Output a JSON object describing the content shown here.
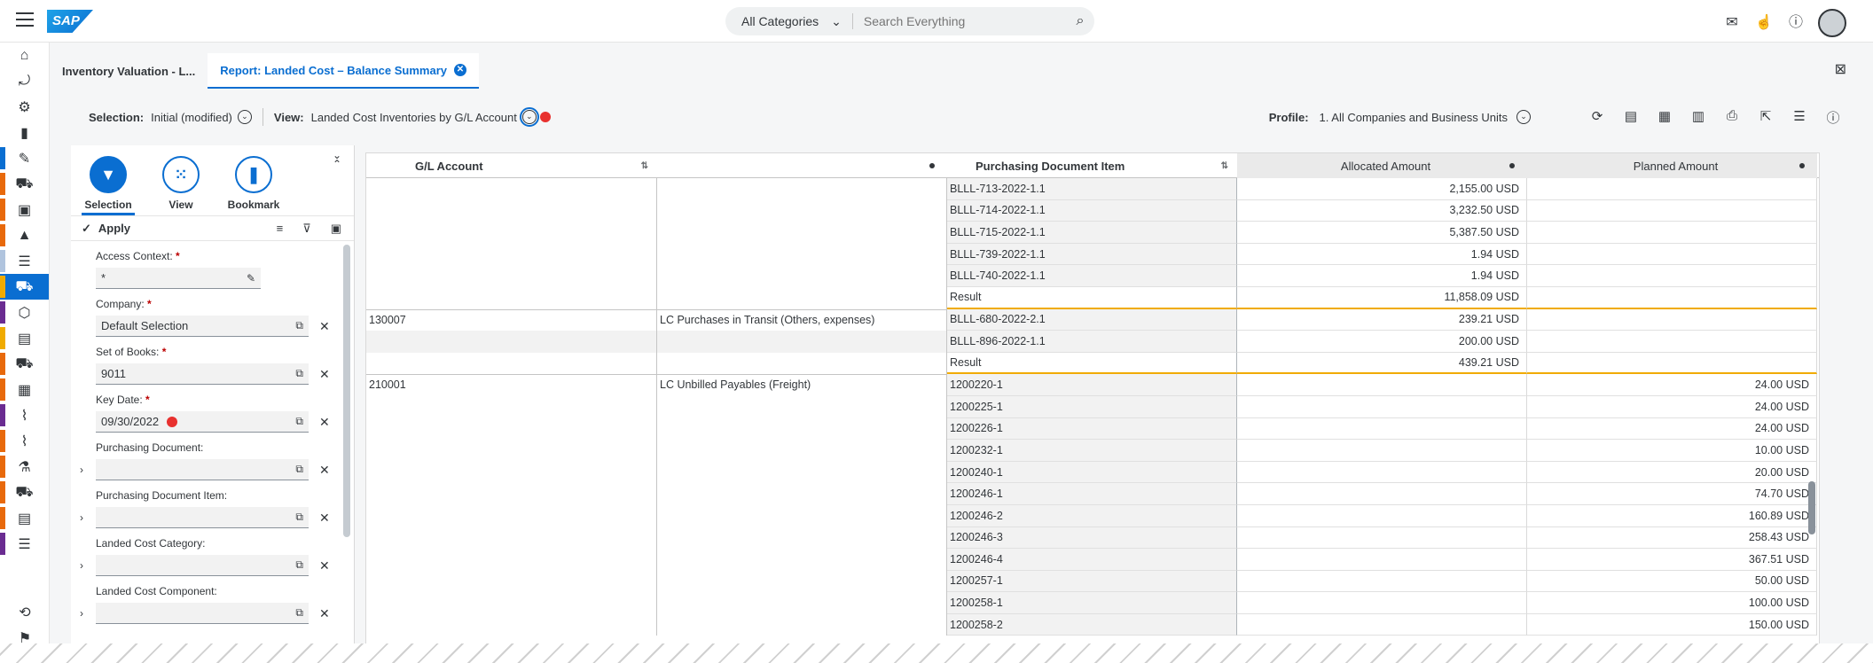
{
  "shell": {
    "logo": "SAP",
    "search_category": "All Categories",
    "search_placeholder": "Search Everything"
  },
  "tabs": [
    {
      "label": "Inventory Valuation - L..."
    },
    {
      "label": "Report: Landed Cost – Balance Summary"
    }
  ],
  "toolbar": {
    "selection_label": "Selection:",
    "selection_value": "Initial (modified)",
    "view_label": "View:",
    "view_value": "Landed Cost Inventories by G/L Account",
    "profile_label": "Profile:",
    "profile_value": "1. All Companies and Business Units"
  },
  "panel": {
    "tabs": [
      "Selection",
      "View",
      "Bookmark"
    ],
    "apply_label": "Apply",
    "fields": [
      {
        "label": "Access Context:",
        "required": true,
        "value": "*"
      },
      {
        "label": "Company:",
        "required": true,
        "value": "Default Selection"
      },
      {
        "label": "Set of Books:",
        "required": true,
        "value": "9011"
      },
      {
        "label": "Key Date:",
        "required": true,
        "value": "09/30/2022"
      },
      {
        "label": "Purchasing Document:",
        "required": false,
        "value": ""
      },
      {
        "label": "Purchasing Document Item:",
        "required": false,
        "value": ""
      },
      {
        "label": "Landed Cost Category:",
        "required": false,
        "value": ""
      },
      {
        "label": "Landed Cost Component:",
        "required": false,
        "value": ""
      }
    ]
  },
  "table": {
    "headers": [
      "G/L Account",
      "Purchasing Document Item",
      "Allocated Amount",
      "Planned Amount"
    ],
    "rows": [
      {
        "gl": "",
        "desc": "",
        "item": "BLLL-713-2022-1.1",
        "alloc": "2,155.00 USD",
        "plan": "",
        "grey": true
      },
      {
        "gl": "",
        "desc": "",
        "item": "BLLL-714-2022-1.1",
        "alloc": "3,232.50 USD",
        "plan": "",
        "grey": true
      },
      {
        "gl": "",
        "desc": "",
        "item": "BLLL-715-2022-1.1",
        "alloc": "5,387.50 USD",
        "plan": "",
        "grey": true
      },
      {
        "gl": "",
        "desc": "",
        "item": "BLLL-739-2022-1.1",
        "alloc": "1.94 USD",
        "plan": "",
        "grey": true
      },
      {
        "gl": "",
        "desc": "",
        "item": "BLLL-740-2022-1.1",
        "alloc": "1.94 USD",
        "plan": "",
        "grey": true
      },
      {
        "gl": "",
        "desc": "",
        "item": "Result",
        "alloc": "11,858.09 USD",
        "plan": "",
        "result": true
      },
      {
        "gl": "130007",
        "desc": "LC Purchases in Transit (Others, expenses)",
        "item": "BLLL-680-2022-2.1",
        "alloc": "239.21 USD",
        "plan": "",
        "grey": true,
        "start": true
      },
      {
        "gl": "",
        "desc": "",
        "item": "BLLL-896-2022-1.1",
        "alloc": "200.00 USD",
        "plan": "",
        "grey": true
      },
      {
        "gl": "",
        "desc": "",
        "item": "Result",
        "alloc": "439.21 USD",
        "plan": "",
        "result": true
      },
      {
        "gl": "210001",
        "desc": "LC Unbilled Payables (Freight)",
        "item": "1200220-1",
        "alloc": "",
        "plan": "24.00 USD",
        "grey": true,
        "start": true
      },
      {
        "gl": "",
        "desc": "",
        "item": "1200225-1",
        "alloc": "",
        "plan": "24.00 USD",
        "grey": true
      },
      {
        "gl": "",
        "desc": "",
        "item": "1200226-1",
        "alloc": "",
        "plan": "24.00 USD",
        "grey": true
      },
      {
        "gl": "",
        "desc": "",
        "item": "1200232-1",
        "alloc": "",
        "plan": "10.00 USD",
        "grey": true
      },
      {
        "gl": "",
        "desc": "",
        "item": "1200240-1",
        "alloc": "",
        "plan": "20.00 USD",
        "grey": true
      },
      {
        "gl": "",
        "desc": "",
        "item": "1200246-1",
        "alloc": "",
        "plan": "74.70 USD",
        "grey": true
      },
      {
        "gl": "",
        "desc": "",
        "item": "1200246-2",
        "alloc": "",
        "plan": "160.89 USD",
        "grey": true
      },
      {
        "gl": "",
        "desc": "",
        "item": "1200246-3",
        "alloc": "",
        "plan": "258.43 USD",
        "grey": true
      },
      {
        "gl": "",
        "desc": "",
        "item": "1200246-4",
        "alloc": "",
        "plan": "367.51 USD",
        "grey": true
      },
      {
        "gl": "",
        "desc": "",
        "item": "1200257-1",
        "alloc": "",
        "plan": "50.00 USD",
        "grey": true
      },
      {
        "gl": "",
        "desc": "",
        "item": "1200258-1",
        "alloc": "",
        "plan": "100.00 USD",
        "grey": true
      },
      {
        "gl": "",
        "desc": "",
        "item": "1200258-2",
        "alloc": "",
        "plan": "150.00 USD",
        "grey": true
      }
    ]
  },
  "colors": {
    "accent": "#0a6ed1",
    "result_line": "#f0ab00",
    "marker": "#e8312f"
  },
  "nav_stripes": [
    "#6a2c91",
    "#e8690b",
    "#6a2c91",
    "#6a2c91",
    "#0a6ed1",
    "#e8690b",
    "#e8690b",
    "#e8690b",
    "#b0c4de",
    "#f0ab00",
    "#6a2c91",
    "#f0ab00",
    "#e8690b",
    "#e8690b",
    "#6a2c91",
    "#e8690b",
    "#e8690b",
    "#e8690b",
    "#e8690b",
    "#6a2c91"
  ]
}
